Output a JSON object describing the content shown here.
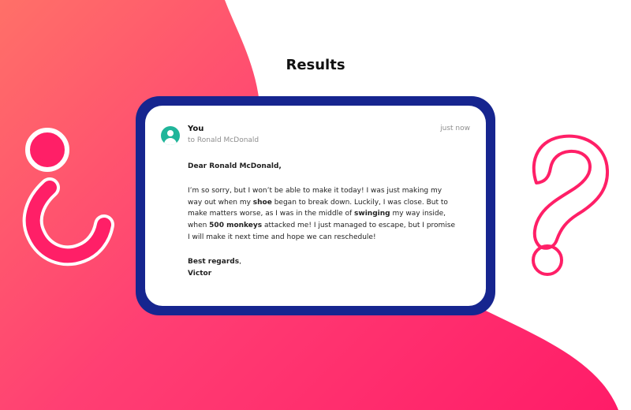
{
  "page": {
    "title": "Results"
  },
  "email": {
    "sender": "You",
    "recipient": "to Ronald McDonald",
    "timestamp": "just now",
    "greeting": "Dear Ronald McDonald,",
    "body": {
      "part1": "I’m so sorry, but I won’t be able to make it today! I was just making my way out when my ",
      "highlight1": "shoe",
      "part2": " began to break down. Luckily, I was close. But to make matters worse, as I was in the middle of ",
      "highlight2": "swinging",
      "part3": " my way inside, when ",
      "highlight3": "500 monkeys",
      "part4": " attacked me! I just managed to escape, but I promise I will make it next time and hope we can reschedule!"
    },
    "signoff": {
      "bold": "Best regards",
      "suffix": ","
    },
    "signature": "Victor"
  },
  "decor": {
    "left_icon": "inverted-question-icon",
    "right_icon": "question-icon"
  },
  "colors": {
    "background_start": "#ff7068",
    "background_end": "#ff1b68",
    "card_border": "#16258f",
    "avatar": "#20b59a",
    "symbol_pink": "#ff1f67"
  }
}
